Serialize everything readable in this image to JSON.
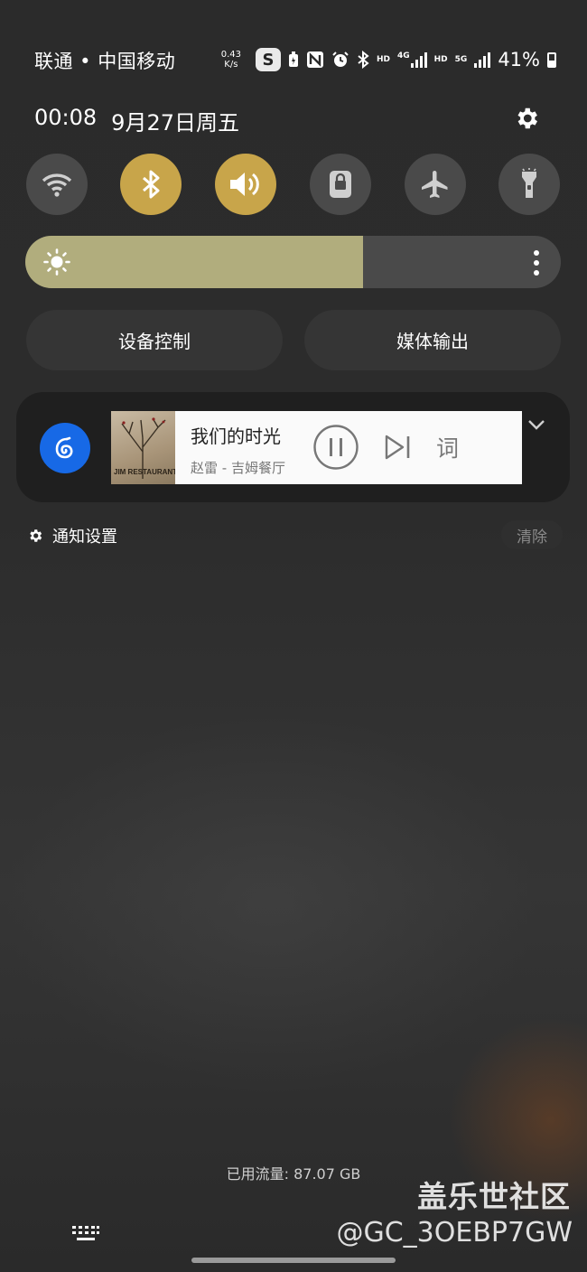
{
  "status_bar": {
    "carrier": "联通 • 中国移动",
    "speed_value": "0.43",
    "speed_unit": "K/s",
    "icons": [
      "s-app-icon",
      "battery-saver-icon",
      "nfc-icon",
      "alarm-icon",
      "bluetooth-icon",
      "hd-icon",
      "4g-signal-icon",
      "hd-icon",
      "5g-signal-icon",
      "signal-icon"
    ],
    "hd1": "HD",
    "net4g": "4G",
    "hd2": "HD",
    "net5g": "5G",
    "battery_percent": "41%"
  },
  "header": {
    "time": "00:08",
    "date": "9月27日周五"
  },
  "quick_toggles": [
    {
      "name": "wifi",
      "icon": "wifi-icon",
      "on": false
    },
    {
      "name": "bluetooth",
      "icon": "bluetooth-icon",
      "on": true
    },
    {
      "name": "sound",
      "icon": "volume-icon",
      "on": true
    },
    {
      "name": "screen-lock",
      "icon": "lock-icon",
      "on": false
    },
    {
      "name": "airplane-mode",
      "icon": "airplane-icon",
      "on": false
    },
    {
      "name": "flashlight",
      "icon": "flashlight-icon",
      "on": false
    }
  ],
  "brightness": {
    "level": 0.63
  },
  "buttons": {
    "device_control": "设备控制",
    "media_output": "媒体输出"
  },
  "media": {
    "song_title": "我们的时光",
    "artist_album": "赵雷 - 吉姆餐厅",
    "lyrics_label": "词",
    "album_text": "JIM RESTAURANT"
  },
  "notification": {
    "settings_label": "通知设置",
    "clear_label": "清除"
  },
  "footer": {
    "data_used": "已用流量: 87.07 GB"
  },
  "watermark": {
    "line1": "盖乐世社区",
    "line2": "@GC_3OEBP7GW"
  },
  "colors": {
    "accent_on": "#c8a54a",
    "brightness_fill": "#b1ad7d",
    "app_blue": "#1769e6"
  }
}
